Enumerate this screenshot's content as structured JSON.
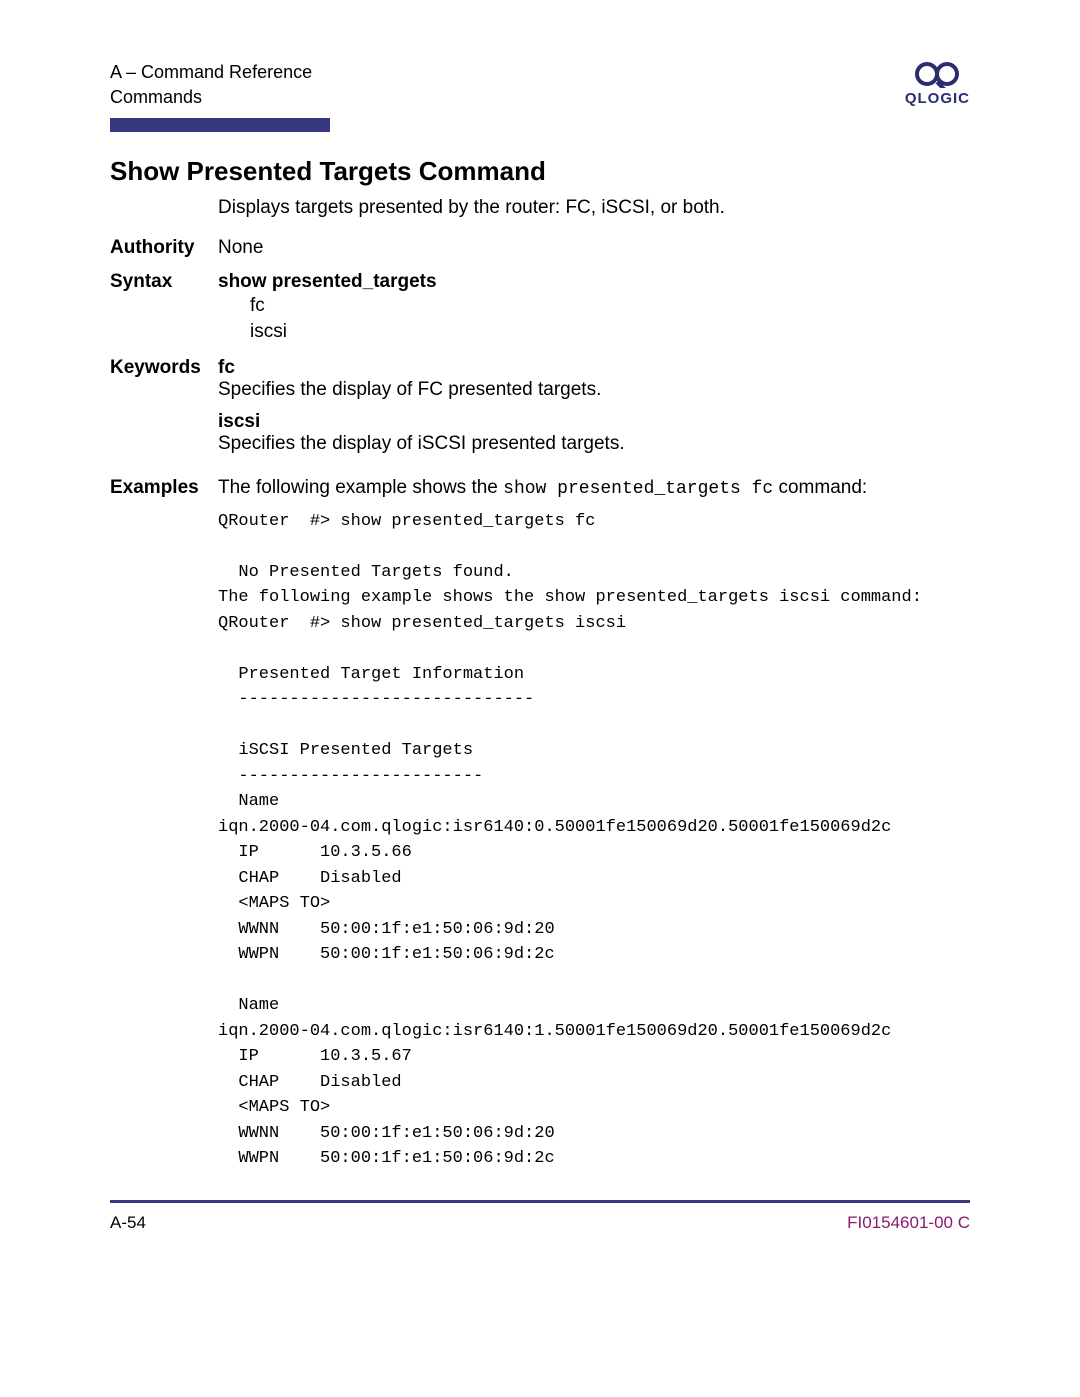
{
  "header": {
    "line1": "A – Command Reference",
    "line2": "Commands",
    "logo_text": "QLOGIC"
  },
  "title": "Show Presented Targets Command",
  "intro": "Displays targets presented by the router: FC, iSCSI, or both.",
  "authority": {
    "label": "Authority",
    "value": "None"
  },
  "syntax": {
    "label": "Syntax",
    "command": "show presented_targets",
    "options": [
      "fc",
      "iscsi"
    ]
  },
  "keywords": {
    "label": "Keywords",
    "items": [
      {
        "kw": "fc",
        "desc": "Specifies the display of FC presented targets."
      },
      {
        "kw": "iscsi",
        "desc": "Specifies the display of iSCSI presented targets."
      }
    ]
  },
  "examples": {
    "label": "Examples",
    "lead_before": "The following example shows the ",
    "lead_code": "show presented_targets fc",
    "lead_after": " command:",
    "console": "QRouter  #> show presented_targets fc\n\n  No Presented Targets found.\nThe following example shows the show presented_targets iscsi command:\nQRouter  #> show presented_targets iscsi\n\n  Presented Target Information\n  -----------------------------\n\n  iSCSI Presented Targets\n  ------------------------\n  Name\niqn.2000-04.com.qlogic:isr6140:0.50001fe150069d20.50001fe150069d2c\n  IP      10.3.5.66\n  CHAP    Disabled\n  <MAPS TO>\n  WWNN    50:00:1f:e1:50:06:9d:20\n  WWPN    50:00:1f:e1:50:06:9d:2c\n\n  Name\niqn.2000-04.com.qlogic:isr6140:1.50001fe150069d20.50001fe150069d2c\n  IP      10.3.5.67\n  CHAP    Disabled\n  <MAPS TO>\n  WWNN    50:00:1f:e1:50:06:9d:20\n  WWPN    50:00:1f:e1:50:06:9d:2c"
  },
  "footer": {
    "left": "A-54",
    "right": "FI0154601-00  C"
  }
}
